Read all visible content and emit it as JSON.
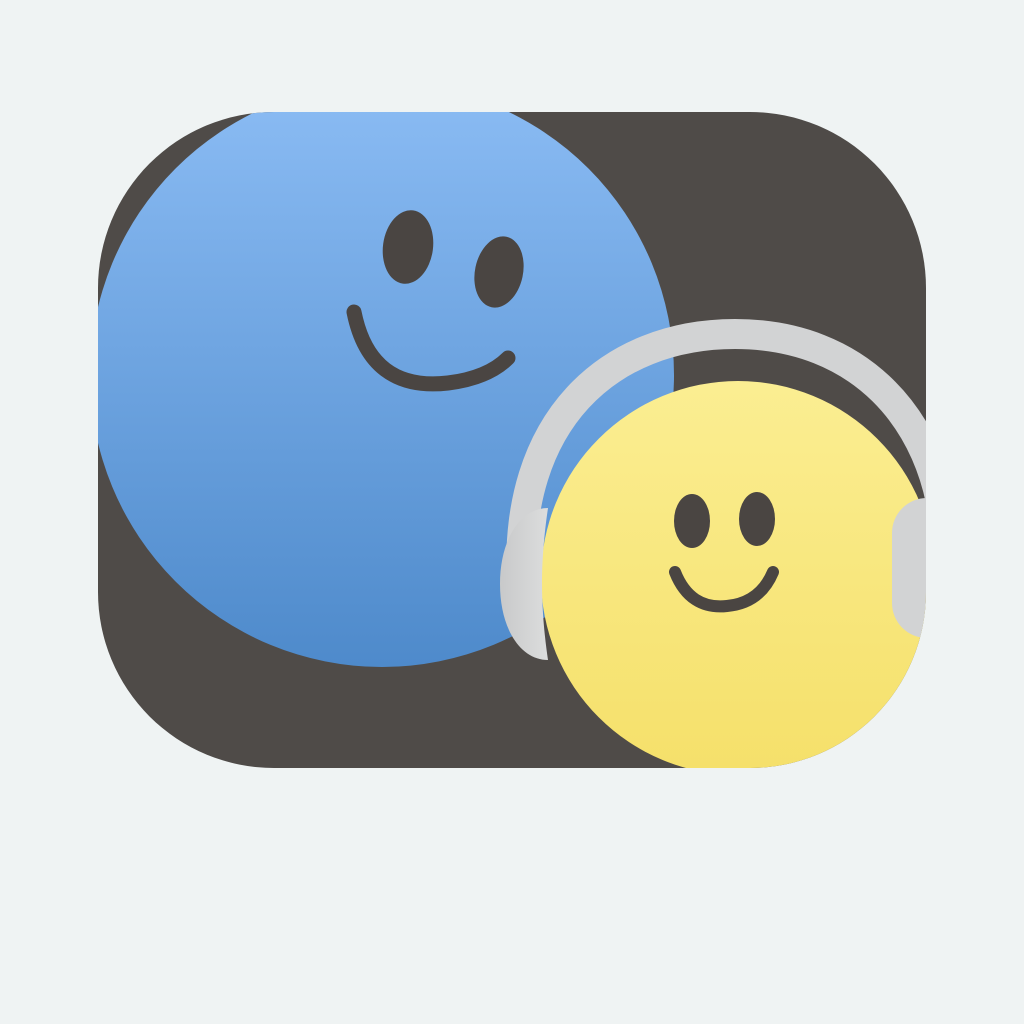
{
  "canvas": {
    "background": "#eff3f3"
  },
  "app_icon": {
    "description_icon": "app-icon",
    "colors": {
      "tile": "#4f4b48",
      "blue_face_top": "#8bbcf4",
      "blue_face_bottom": "#4e8acb",
      "yellow_face_top": "#fbee92",
      "yellow_face_bottom": "#f5e06a",
      "headphones": "#d2d3d4",
      "features": "#4a4542"
    },
    "characters": [
      {
        "name": "blue-smiley-icon",
        "expression": "smile"
      },
      {
        "name": "yellow-smiley-with-headphones-icon",
        "expression": "smile",
        "accessory": "headphones"
      }
    ]
  }
}
